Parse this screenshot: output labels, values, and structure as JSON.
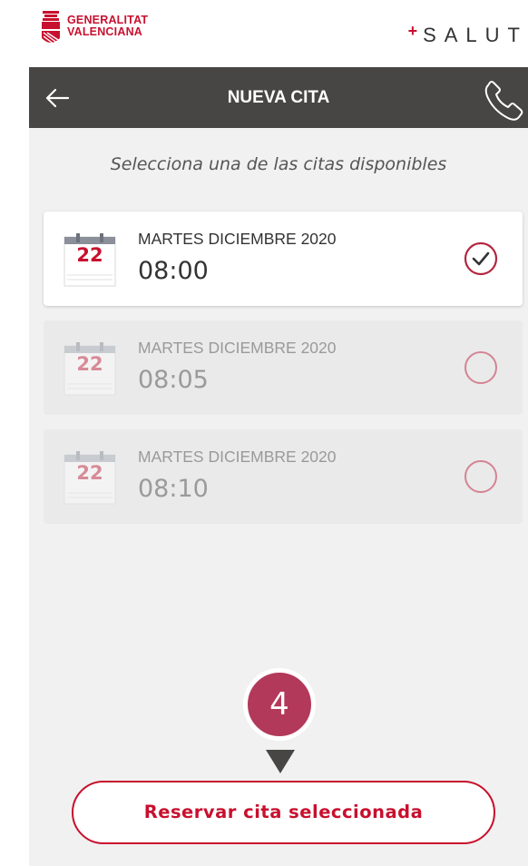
{
  "brand": {
    "gv_line1": "GENERALITAT",
    "gv_line2": "VALENCIANA",
    "salut_plus": "+",
    "salut_text": "SALUT"
  },
  "header": {
    "title": "NUEVA CITA",
    "back_icon": "arrow-left-icon",
    "call_icon": "phone-icon"
  },
  "subtitle": "Selecciona una de las citas disponibles",
  "slots": [
    {
      "day": "22",
      "date": "MARTES DICIEMBRE 2020",
      "time": "08:00",
      "selected": true
    },
    {
      "day": "22",
      "date": "MARTES DICIEMBRE 2020",
      "time": "08:05",
      "selected": false
    },
    {
      "day": "22",
      "date": "MARTES DICIEMBRE 2020",
      "time": "08:10",
      "selected": false
    }
  ],
  "step_badge": "4",
  "reserve_button": "Reservar cita seleccionada",
  "colors": {
    "brand_red": "#c8102e",
    "header_dark": "#474645",
    "background": "#f1f1f1",
    "badge": "#b3395a"
  }
}
